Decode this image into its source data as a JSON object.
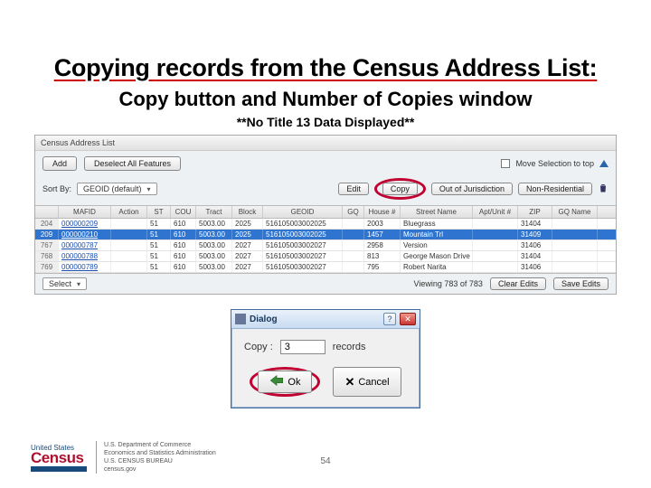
{
  "slide": {
    "title": "Copying records from the Census Address List:",
    "subtitle": "Copy button and Number of Copies window",
    "notice": "**No Title 13 Data Displayed**",
    "page_number": "54"
  },
  "panel": {
    "title": "Census Address List",
    "add_btn": "Add",
    "deselect_btn": "Deselect All Features",
    "move_top_label": "Move Selection to top",
    "edit_btn": "Edit",
    "copy_btn": "Copy",
    "out_btn": "Out of Jurisdiction",
    "nonres_btn": "Non-Residential",
    "sort_label": "Sort By:",
    "sort_value": "GEOID (default)",
    "viewing": "Viewing 783 of 783",
    "clear_btn": "Clear Edits",
    "save_btn": "Save Edits",
    "footer_select": "Select"
  },
  "columns": [
    "",
    "MAFID",
    "Action",
    "ST",
    "COU",
    "Tract",
    "Block",
    "GEOID",
    "GQ",
    "House #",
    "Street Name",
    "Apt/Unit #",
    "ZIP",
    "GQ Name"
  ],
  "rows": [
    {
      "n": "204",
      "mafid": "000000209",
      "st": "51",
      "cou": "610",
      "tract": "5003.00",
      "block": "2025",
      "geoid": "516105003002025",
      "house": "2003",
      "street": "Bluegrass",
      "zip": "31404"
    },
    {
      "n": "209",
      "mafid": "000000210",
      "st": "51",
      "cou": "610",
      "tract": "5003.00",
      "block": "2025",
      "geoid": "516105003002025",
      "house": "1457",
      "street": "Mountain Trl",
      "zip": "31409",
      "sel": true
    },
    {
      "n": "767",
      "mafid": "000000787",
      "st": "51",
      "cou": "610",
      "tract": "5003.00",
      "block": "2027",
      "geoid": "516105003002027",
      "house": "2958",
      "street": "Version",
      "zip": "31406"
    },
    {
      "n": "768",
      "mafid": "000000788",
      "st": "51",
      "cou": "610",
      "tract": "5003.00",
      "block": "2027",
      "geoid": "516105003002027",
      "house": "813",
      "street": "George Mason Drive",
      "zip": "31404"
    },
    {
      "n": "769",
      "mafid": "000000789",
      "st": "51",
      "cou": "610",
      "tract": "5003.00",
      "block": "2027",
      "geoid": "516105003002027",
      "house": "795",
      "street": "Robert Narita",
      "zip": "31406"
    }
  ],
  "dialog": {
    "title": "Dialog",
    "copy_label": "Copy :",
    "copy_value": "3",
    "records_label": "records",
    "ok": "Ok",
    "cancel": "Cancel"
  },
  "footer": {
    "united_states": "United States",
    "census": "Census",
    "bureau": "Bureau",
    "dept1": "U.S. Department of Commerce",
    "dept2": "Economics and Statistics Administration",
    "dept3": "U.S. CENSUS BUREAU",
    "site": "census.gov"
  }
}
